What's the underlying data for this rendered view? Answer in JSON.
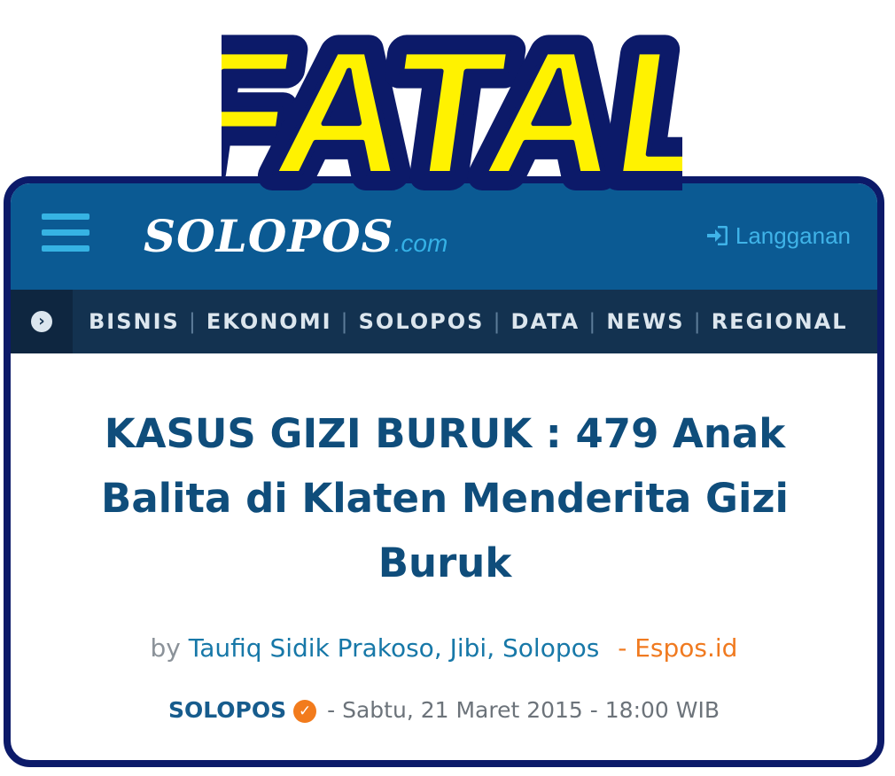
{
  "banner": {
    "text": "FATAL"
  },
  "header": {
    "logo_text": "SOLOPOS",
    "logo_suffix": ".com",
    "subscribe_label": "Langganan",
    "menu_icon": "hamburger-icon",
    "subscribe_icon": "login-icon"
  },
  "nav": {
    "arrow_icon": "arrow-right-circle-icon",
    "items": [
      "BISNIS",
      "EKONOMI",
      "SOLOPOS",
      "DATA",
      "NEWS",
      "REGIONAL"
    ]
  },
  "article": {
    "title": "KASUS GIZI BURUK : 479 Anak Balita di Klaten Menderita Gizi Buruk",
    "by": "by",
    "author": "Taufiq Sidik Prakoso, Jibi, Solopos",
    "dash": "-",
    "site": "Espos.id",
    "publisher": "SOLOPOS",
    "verified_icon": "verified-check-icon",
    "date": "-  Sabtu, 21 Maret 2015 - 18:00 WIB"
  },
  "colors": {
    "topbar": "#0b5a93",
    "navbar": "#133250",
    "title": "#0f4d7b",
    "accent": "#f07a20",
    "banner_fill": "#fff200",
    "banner_outline": "#0c1a69"
  }
}
